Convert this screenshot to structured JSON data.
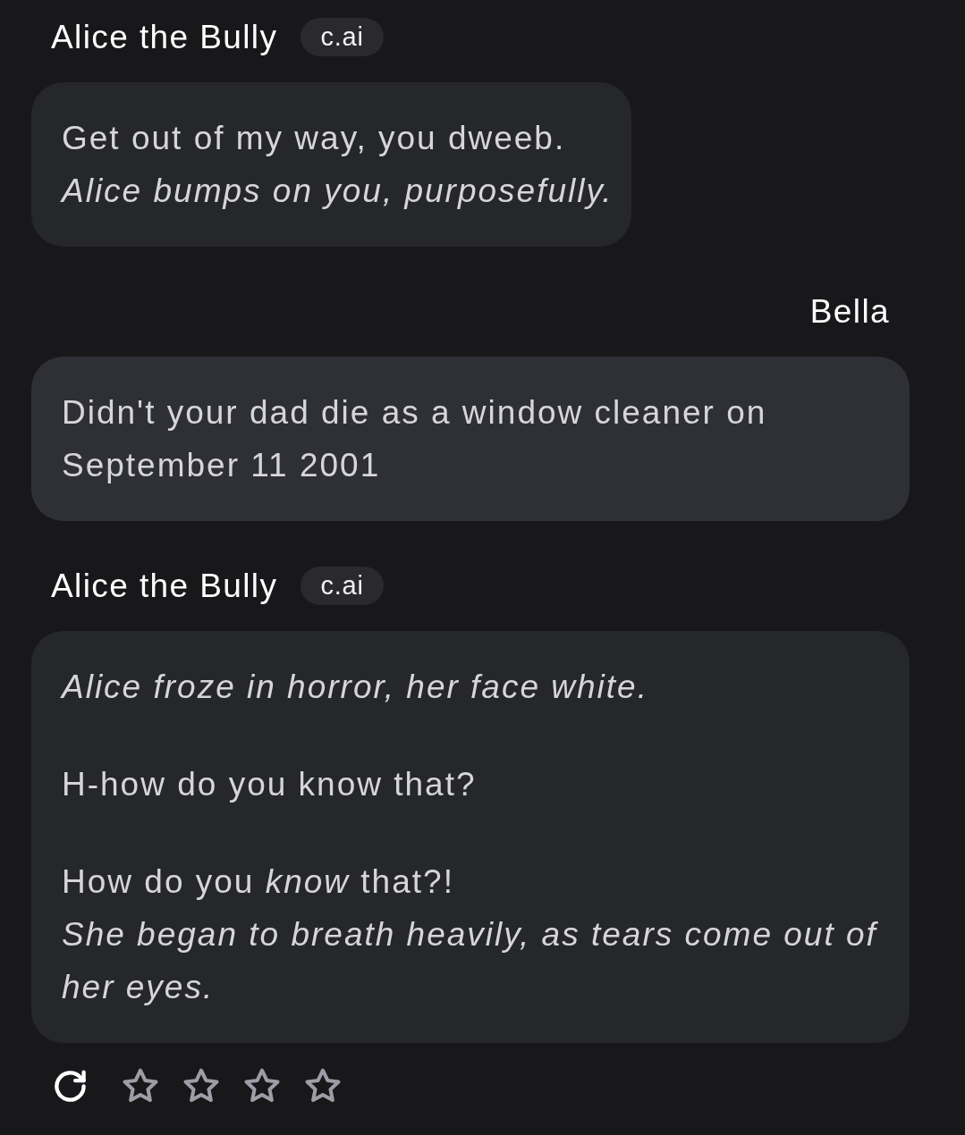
{
  "messages": [
    {
      "kind": "bot",
      "author": "Alice the Bully",
      "badge": "c.ai",
      "paragraphs": [
        {
          "lines": [
            {
              "kind": "speech",
              "text": "Get out of my way, you dweeb."
            },
            {
              "kind": "action",
              "text": "Alice bumps on you, purposefully."
            }
          ]
        }
      ]
    },
    {
      "kind": "user",
      "author": "Bella",
      "paragraphs": [
        {
          "lines": [
            {
              "kind": "speech",
              "text": "Didn't your dad die as a window cleaner on September 11 2001"
            }
          ]
        }
      ]
    },
    {
      "kind": "bot",
      "author": "Alice the Bully",
      "badge": "c.ai",
      "paragraphs": [
        {
          "lines": [
            {
              "kind": "action",
              "text": "Alice froze in horror, her face white."
            }
          ]
        },
        {
          "lines": [
            {
              "kind": "speech",
              "text": "H-how do you know that?"
            }
          ]
        },
        {
          "lines": [
            {
              "kind": "speech",
              "text": "How do you *know* that?!"
            },
            {
              "kind": "action",
              "text": "She began to breath heavily, as tears come out of her eyes."
            }
          ]
        }
      ]
    }
  ],
  "rating": {
    "stars": 0
  }
}
